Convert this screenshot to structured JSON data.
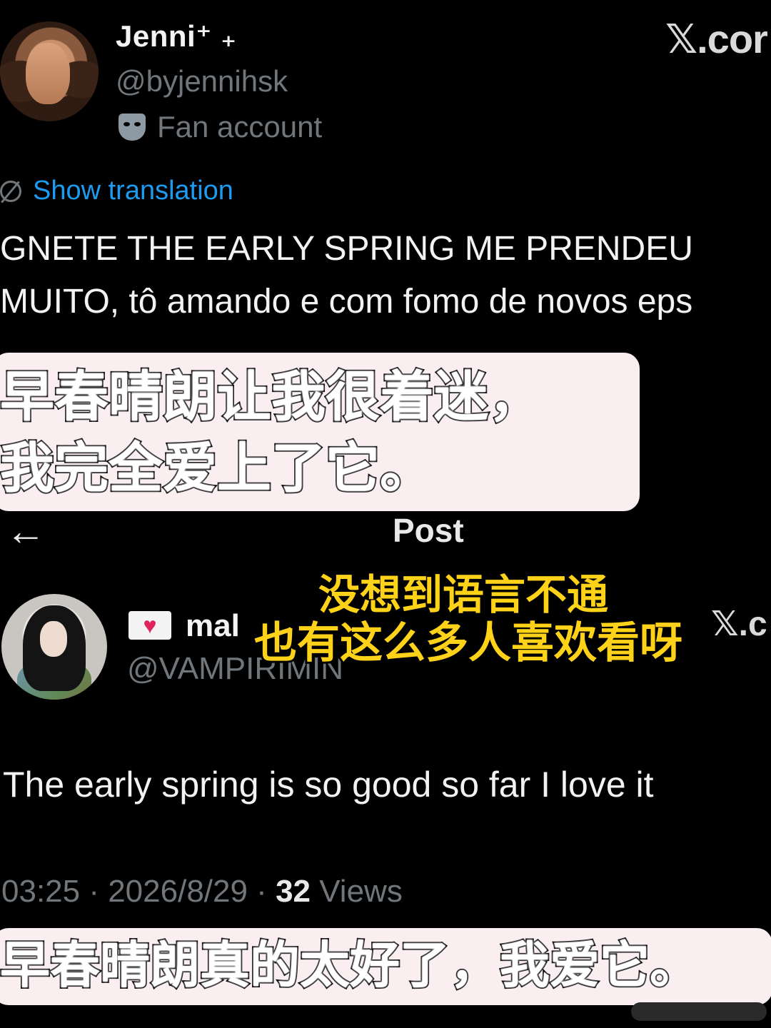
{
  "tweet1": {
    "display_name": "Jenni⁺ ₊",
    "handle": "@byjennihsk",
    "badge": "Fan account",
    "translate_label": "Show translation",
    "text_line1": "GNETE THE EARLY SPRING ME PRENDEU",
    "text_line2": "MUITO, tô amando e com fomo de novos eps",
    "brand": "𝕏.cor"
  },
  "caption1": {
    "line1": "早春晴朗让我很着迷，",
    "line2": "我完全爱上了它。"
  },
  "post_header": {
    "title": "Post"
  },
  "yellow_caption": {
    "line1": "没想到语言不通",
    "line2": "也有这么多人喜欢看呀"
  },
  "tweet2": {
    "display_name": "mal",
    "handle": "@VAMPIRIMIN",
    "text": "The early spring is so good so far I love it",
    "time": "03:25 · 2026/8/29 · ",
    "views_count": "32",
    "views_label": " Views",
    "brand": "𝕏.c"
  },
  "caption2": {
    "text": "早春晴朗真的太好了，我爱它。"
  },
  "icons": {
    "mask": "performing-arts-mask-icon",
    "globe": "translate-globe-icon",
    "heart": "love-letter-heart-icon",
    "back": "back-arrow-icon"
  },
  "colors": {
    "background": "#000000",
    "link_blue": "#1d9bf0",
    "muted_gray": "#71767b",
    "caption_bg": "#fbeef0",
    "yellow_caption": "#ffd21a"
  }
}
